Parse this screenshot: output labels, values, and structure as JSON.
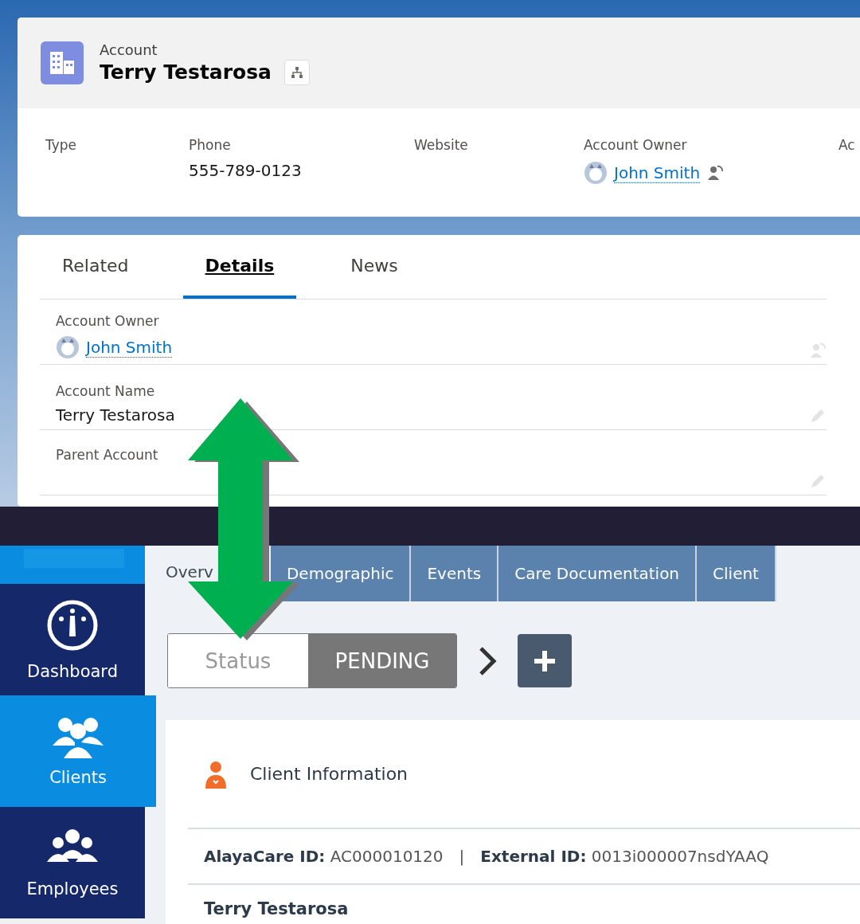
{
  "account_header": {
    "object_label": "Account",
    "title": "Terry Testarosa"
  },
  "highlights": [
    {
      "label": "Type"
    },
    {
      "label": "Phone",
      "value": "555-789-0123",
      "kind": "text"
    },
    {
      "label": "Website"
    },
    {
      "label": "Account Owner",
      "value": "John Smith",
      "kind": "user"
    },
    {
      "label": "Ac"
    }
  ],
  "record_tabs": [
    {
      "label": "Related",
      "selected": false
    },
    {
      "label": "Details",
      "selected": true
    },
    {
      "label": "News",
      "selected": false
    }
  ],
  "detail_fields": [
    {
      "label": "Account Owner",
      "value": "John Smith",
      "kind": "user"
    },
    {
      "label": "Account Name",
      "value": "Terry Testarosa",
      "kind": "text"
    },
    {
      "label": "Parent Account",
      "kind": "text"
    }
  ],
  "sidebar": {
    "items": [
      {
        "label": "Dashboard",
        "selected": false
      },
      {
        "label": "Clients",
        "selected": true
      },
      {
        "label": "Employees",
        "selected": false
      }
    ]
  },
  "client_tabs": [
    {
      "label": "Overv",
      "selected": true
    },
    {
      "label": "Demographic",
      "selected": false
    },
    {
      "label": "Events",
      "selected": false
    },
    {
      "label": "Care Documentation",
      "selected": false
    },
    {
      "label": "Client",
      "selected": false
    }
  ],
  "status": {
    "label": "Status",
    "value": "PENDING"
  },
  "client_card": {
    "title": "Client Information",
    "ids": [
      "**AlayaCare ID:** AC000010120",
      "**External ID:** 0013i000007nsdYAAQ"
    ],
    "separator": "|",
    "name": "Terry Testarosa"
  }
}
